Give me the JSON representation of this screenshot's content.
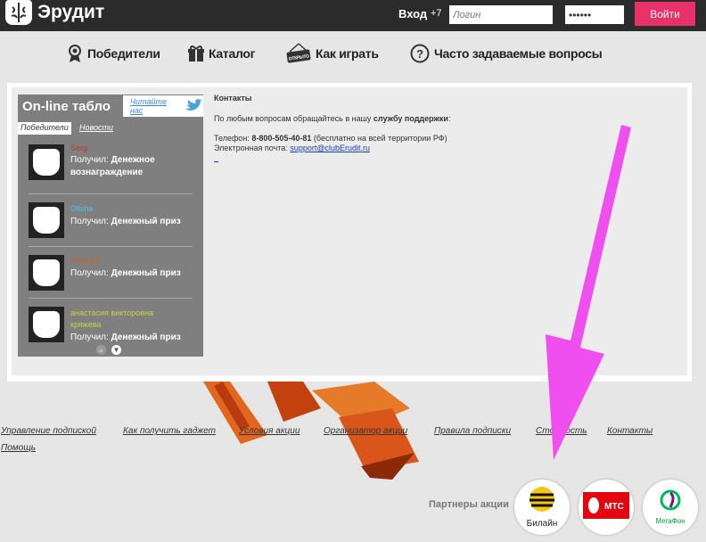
{
  "header": {
    "logo_text": "Эрудит",
    "login_label": "Вход",
    "phone_prefix": "+7",
    "phone_placeholder": "Логин",
    "password_value": "••••••",
    "login_button": "Войти"
  },
  "nav": {
    "items": [
      {
        "label": "Победители",
        "icon": "award-icon"
      },
      {
        "label": "Каталог",
        "icon": "gift-icon"
      },
      {
        "label": "Как играть",
        "icon": "open-sign-icon",
        "icon_text": "ОТКРЫТО"
      },
      {
        "label": "Часто задаваемые вопросы",
        "icon": "question-icon"
      }
    ]
  },
  "board": {
    "title": "On-line табло",
    "follow_text": "Читайте нас",
    "tabs": [
      "Победители",
      "Новости"
    ],
    "entries": [
      {
        "name": "Serg",
        "name_color": "#c0392b",
        "prefix": "Получил: ",
        "prize": "Денежное вознаграждение"
      },
      {
        "name": "Olisha",
        "name_color": "#4ec3e8",
        "prefix": "Получил: ",
        "prize": "Денежный приз"
      },
      {
        "name": "Natasha",
        "name_color": "#c0652b",
        "prefix": "Получил: ",
        "prize": "Денежный приз"
      },
      {
        "name": "анастасия викторовна кряжева",
        "name_color": "#c9d14a",
        "prefix": "Получил: ",
        "prize": "Денежный приз"
      }
    ]
  },
  "contacts": {
    "heading": "Контакты",
    "intro_prefix": "По любым вопросам обращайтесь в нашу ",
    "intro_bold": "службу поддержки",
    "intro_suffix": ":",
    "phone_label": "Телефон: ",
    "phone_number": "8-800-505-40-81",
    "phone_note": " (бесплатно на всей территории РФ)",
    "email_label": "Электронная почта: ",
    "email": "support@clubErudit.ru",
    "underscore": "_"
  },
  "footer": {
    "links": [
      "Управление подпиской",
      "Как получить гаджет",
      "Условия акции",
      "Организатор акции",
      "Правила подписки",
      "Стоимость",
      "Контакты",
      "Помощь"
    ]
  },
  "partners": {
    "label": "Партнеры акции",
    "items": [
      {
        "name": "Билайн",
        "color": "#f5c518"
      },
      {
        "name": "МТС",
        "color": "#e30611"
      },
      {
        "name": "МегаФон",
        "color": "#00b956"
      }
    ]
  },
  "colors": {
    "accent": "#e8316a",
    "annotation_arrow": "#f04ff0",
    "ribbon": "#e2661e"
  }
}
